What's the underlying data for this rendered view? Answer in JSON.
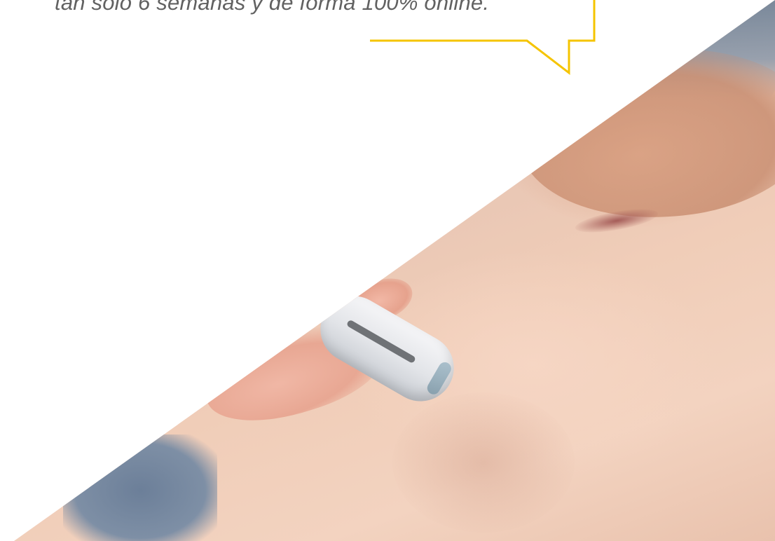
{
  "quote": {
    "text": "tan solo 6 semanas y de forma 100% online."
  },
  "colors": {
    "accent_yellow": "#F5C400",
    "quote_text": "#616161",
    "background": "#FFFFFF"
  }
}
